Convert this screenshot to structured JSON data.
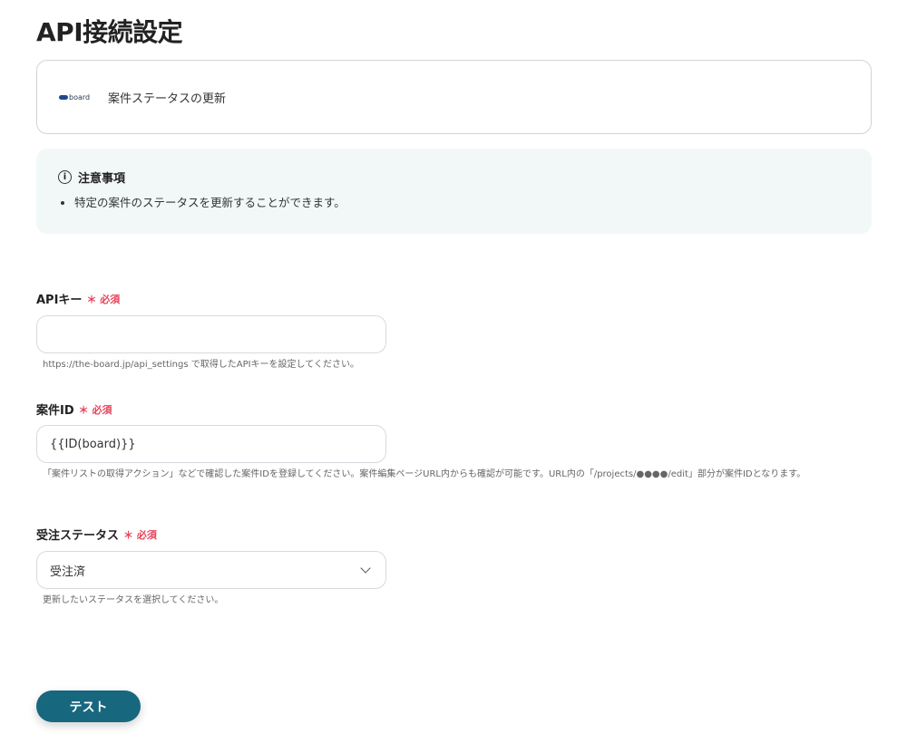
{
  "page_title": "API接続設定",
  "action_card": {
    "logo_text": "board",
    "title": "案件ステータスの更新"
  },
  "notice": {
    "heading": "注意事項",
    "items": [
      "特定の案件のステータスを更新することができます。"
    ]
  },
  "fields": [
    {
      "label": "APIキー",
      "required": "＊ 必須",
      "value": "",
      "help": "https://the-board.jp/api_settings で取得したAPIキーを設定してください。"
    },
    {
      "label": "案件ID",
      "required": "＊ 必須",
      "value": "{{ID(board)}}",
      "help": "「案件リストの取得アクション」などで確認した案件IDを登録してください。案件編集ページURL内からも確認が可能です。URL内の「/projects/●●●●/edit」部分が案件IDとなります。"
    },
    {
      "label": "受注ステータス",
      "required": "＊ 必須",
      "value": "受注済",
      "help": "更新したいステータスを選択してください。"
    }
  ],
  "test_button": "テスト",
  "colors": {
    "primary": "#17677f",
    "required": "#e8435a",
    "notice_bg": "#f2f8f8"
  }
}
